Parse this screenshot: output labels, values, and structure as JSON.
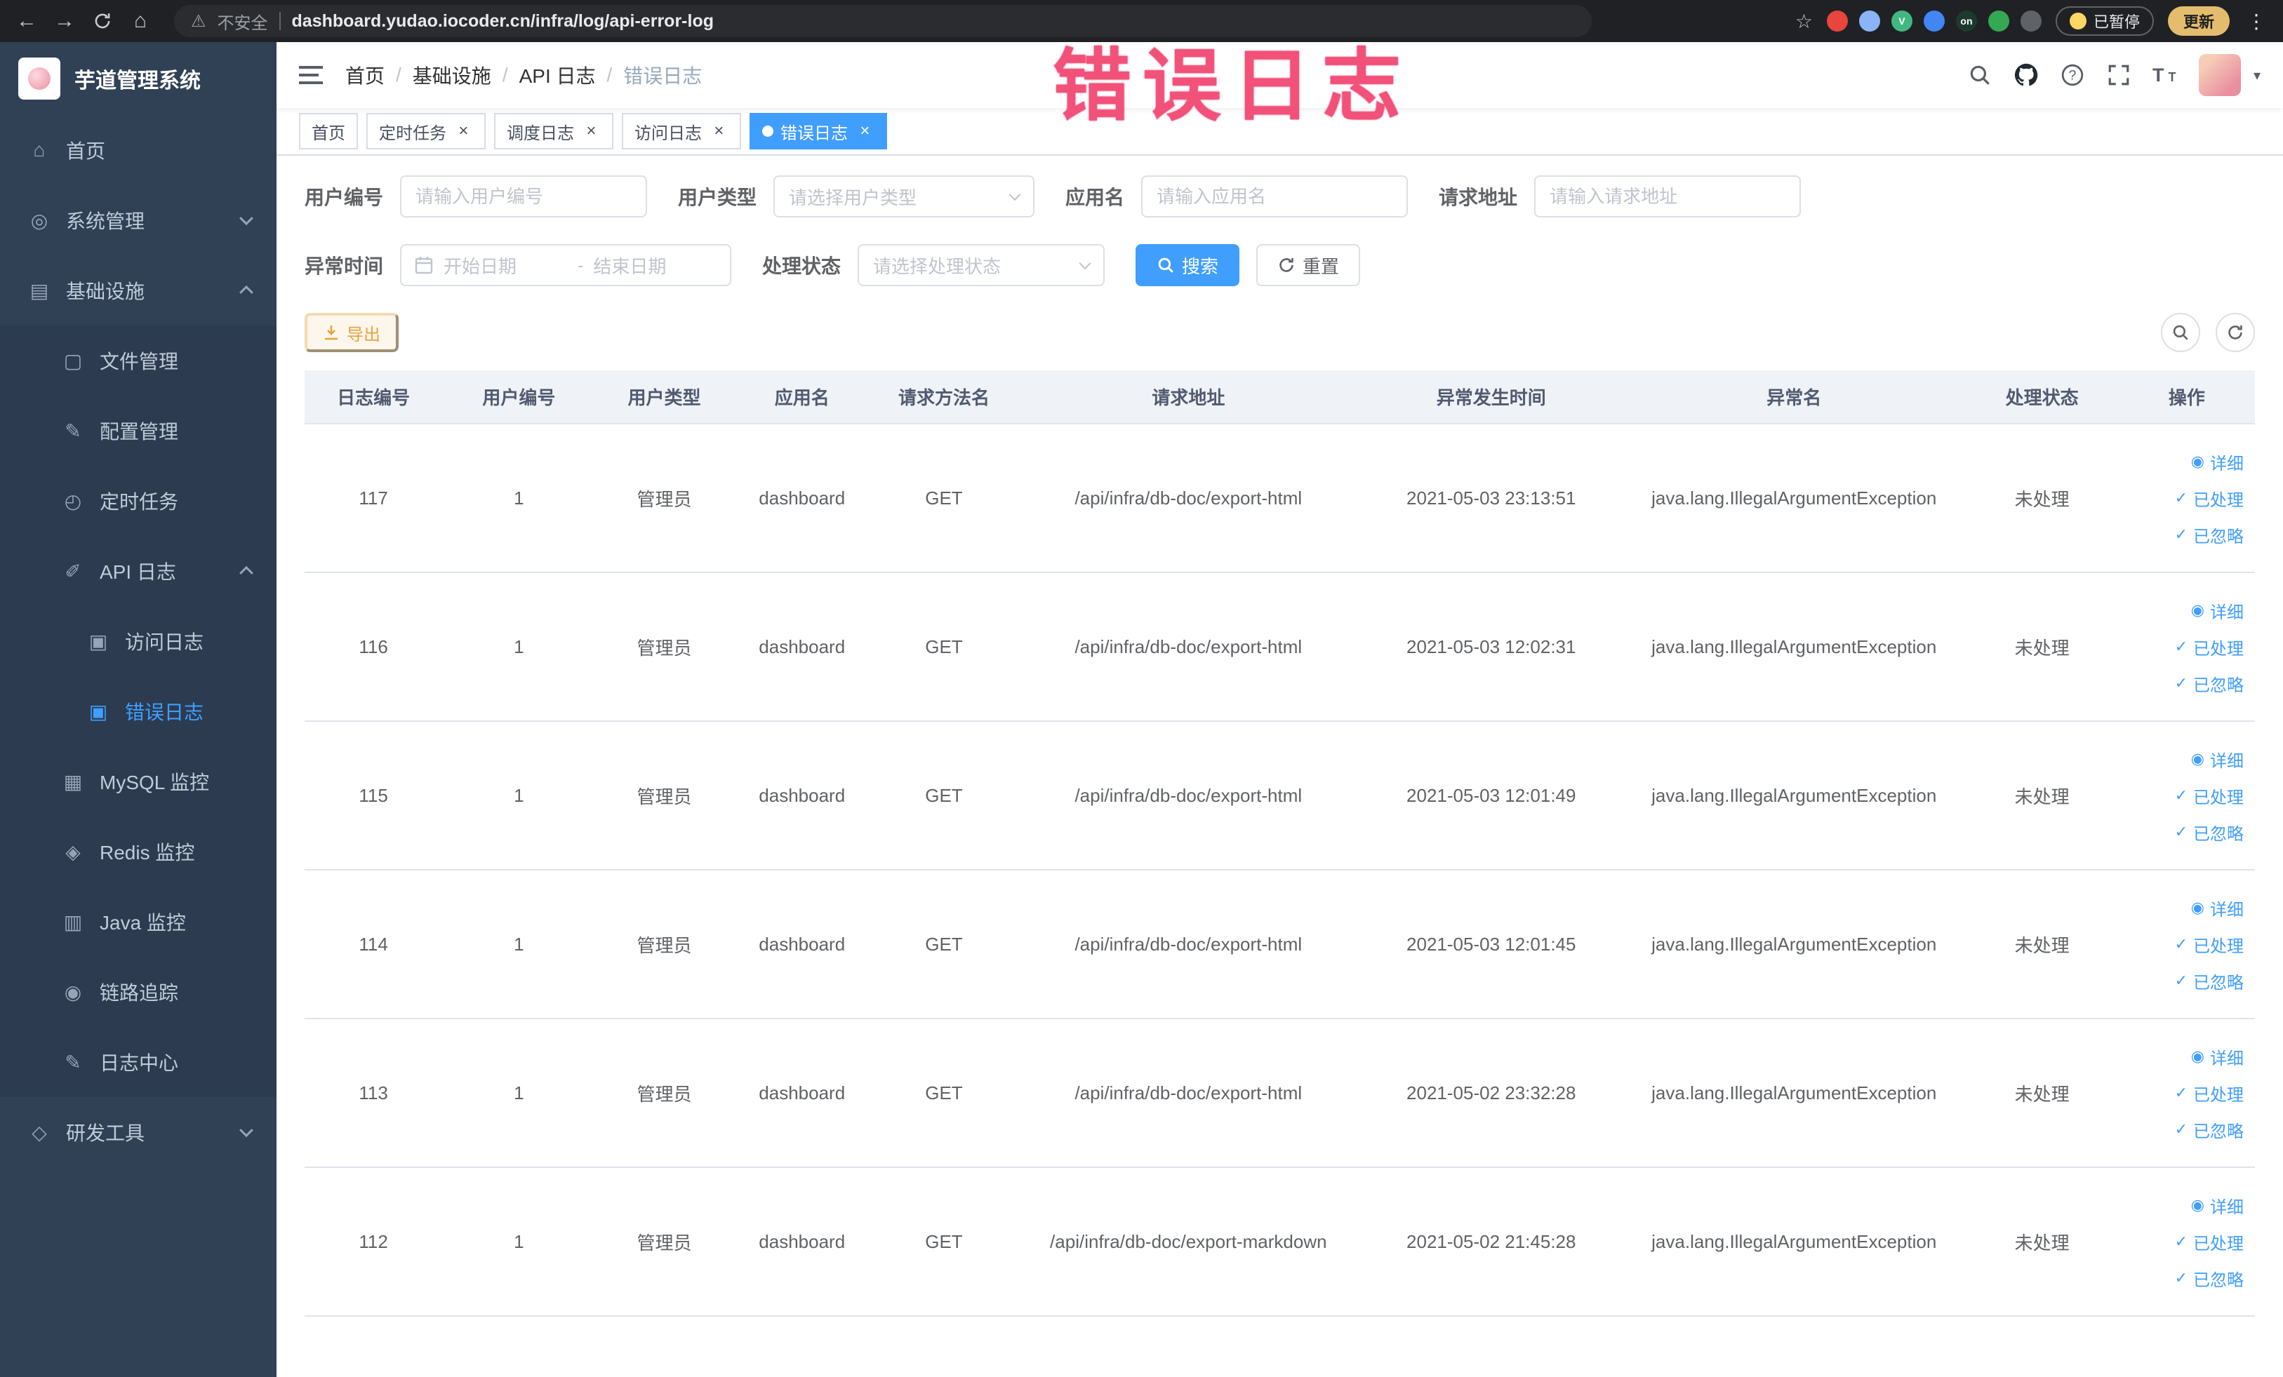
{
  "annotation": {
    "text": "错误日志"
  },
  "browser": {
    "security_label": "不安全",
    "url": "dashboard.yudao.iocoder.cn/infra/log/api-error-log",
    "paused_badge": "已暂停",
    "update_label": "更新",
    "extensions": [
      {
        "id": "extension-red",
        "color": "#e8453c"
      },
      {
        "id": "extension-lightblue",
        "color": "#8ab4f8"
      },
      {
        "id": "extension-vue",
        "color": "#41b883",
        "text": "V"
      },
      {
        "id": "extension-blue-grid",
        "color": "#4285f4"
      },
      {
        "id": "extension-on",
        "color": "#1e3a2f",
        "text": "on"
      },
      {
        "id": "extension-green",
        "color": "#34a853"
      },
      {
        "id": "extension-gray",
        "color": "#5f6368"
      }
    ]
  },
  "sidebar": {
    "logo_title": "芋道管理系统",
    "items": [
      {
        "id": "home",
        "label": "首页",
        "icon": "home-icon",
        "level": 1
      },
      {
        "id": "system",
        "label": "系统管理",
        "icon": "gear-icon",
        "level": 1,
        "chevron": "down"
      },
      {
        "id": "infra",
        "label": "基础设施",
        "icon": "infra-icon",
        "level": 1,
        "chevron": "up"
      },
      {
        "id": "file-manage",
        "label": "文件管理",
        "icon": "file-icon",
        "level": 2
      },
      {
        "id": "config-manage",
        "label": "配置管理",
        "icon": "config-icon",
        "level": 2
      },
      {
        "id": "cron-job",
        "label": "定时任务",
        "icon": "timer-icon",
        "level": 2
      },
      {
        "id": "api-log",
        "label": "API 日志",
        "icon": "log-icon",
        "level": 2,
        "chevron": "up"
      },
      {
        "id": "access-log",
        "label": "访问日志",
        "icon": "doc-icon",
        "level": 3
      },
      {
        "id": "error-log",
        "label": "错误日志",
        "icon": "doc-icon",
        "level": 3,
        "active": true
      },
      {
        "id": "mysql-monitor",
        "label": "MySQL 监控",
        "icon": "mysql-icon",
        "level": 2
      },
      {
        "id": "redis-monitor",
        "label": "Redis 监控",
        "icon": "redis-icon",
        "level": 2
      },
      {
        "id": "java-monitor",
        "label": "Java 监控",
        "icon": "java-icon",
        "level": 2
      },
      {
        "id": "trace",
        "label": "链路追踪",
        "icon": "trace-icon",
        "level": 2
      },
      {
        "id": "log-center",
        "label": "日志中心",
        "icon": "log-center-icon",
        "level": 2
      },
      {
        "id": "dev-tools",
        "label": "研发工具",
        "icon": "tools-icon",
        "level": 1,
        "chevron": "down"
      }
    ]
  },
  "header": {
    "breadcrumb": [
      "首页",
      "基础设施",
      "API 日志",
      "错误日志"
    ]
  },
  "tabs": [
    {
      "id": "home",
      "label": "首页",
      "active": false,
      "closable": false
    },
    {
      "id": "cron-job",
      "label": "定时任务",
      "active": false,
      "closable": true
    },
    {
      "id": "schedule-log",
      "label": "调度日志",
      "active": false,
      "closable": true
    },
    {
      "id": "access-log",
      "label": "访问日志",
      "active": false,
      "closable": true
    },
    {
      "id": "error-log",
      "label": "错误日志",
      "active": true,
      "closable": true
    }
  ],
  "filters": {
    "user_id": {
      "label": "用户编号",
      "placeholder": "请输入用户编号"
    },
    "user_type": {
      "label": "用户类型",
      "placeholder": "请选择用户类型"
    },
    "app_name": {
      "label": "应用名",
      "placeholder": "请输入应用名"
    },
    "request_url": {
      "label": "请求地址",
      "placeholder": "请输入请求地址"
    },
    "exception_time": {
      "label": "异常时间",
      "start_placeholder": "开始日期",
      "separator": "-",
      "end_placeholder": "结束日期"
    },
    "process_status": {
      "label": "处理状态",
      "placeholder": "请选择处理状态"
    },
    "search_label": "搜索",
    "reset_label": "重置"
  },
  "toolbar": {
    "export_label": "导出"
  },
  "table": {
    "columns": [
      "日志编号",
      "用户编号",
      "用户类型",
      "应用名",
      "请求方法名",
      "请求地址",
      "异常发生时间",
      "异常名",
      "处理状态",
      "操作"
    ],
    "row_actions": [
      {
        "id": "detail",
        "label": "详细",
        "glyph": "◉",
        "icon": "eye-icon"
      },
      {
        "id": "processed",
        "label": "已处理",
        "glyph": "✓",
        "icon": "check-icon"
      },
      {
        "id": "ignored",
        "label": "已忽略",
        "glyph": "✓",
        "icon": "check-icon"
      }
    ],
    "rows": [
      {
        "log_id": "117",
        "user_id": "1",
        "user_type": "管理员",
        "app_name": "dashboard",
        "method": "GET",
        "request_url": "/api/infra/db-doc/export-html",
        "time": "2021-05-03 23:13:51",
        "exception": "java.lang.IllegalArgumentException",
        "status": "未处理"
      },
      {
        "log_id": "116",
        "user_id": "1",
        "user_type": "管理员",
        "app_name": "dashboard",
        "method": "GET",
        "request_url": "/api/infra/db-doc/export-html",
        "time": "2021-05-03 12:02:31",
        "exception": "java.lang.IllegalArgumentException",
        "status": "未处理"
      },
      {
        "log_id": "115",
        "user_id": "1",
        "user_type": "管理员",
        "app_name": "dashboard",
        "method": "GET",
        "request_url": "/api/infra/db-doc/export-html",
        "time": "2021-05-03 12:01:49",
        "exception": "java.lang.IllegalArgumentException",
        "status": "未处理"
      },
      {
        "log_id": "114",
        "user_id": "1",
        "user_type": "管理员",
        "app_name": "dashboard",
        "method": "GET",
        "request_url": "/api/infra/db-doc/export-html",
        "time": "2021-05-03 12:01:45",
        "exception": "java.lang.IllegalArgumentException",
        "status": "未处理"
      },
      {
        "log_id": "113",
        "user_id": "1",
        "user_type": "管理员",
        "app_name": "dashboard",
        "method": "GET",
        "request_url": "/api/infra/db-doc/export-html",
        "time": "2021-05-02 23:32:28",
        "exception": "java.lang.IllegalArgumentException",
        "status": "未处理"
      },
      {
        "log_id": "112",
        "user_id": "1",
        "user_type": "管理员",
        "app_name": "dashboard",
        "method": "GET",
        "request_url": "/api/infra/db-doc/export-markdown",
        "time": "2021-05-02 21:45:28",
        "exception": "java.lang.IllegalArgumentException",
        "status": "未处理"
      }
    ]
  }
}
